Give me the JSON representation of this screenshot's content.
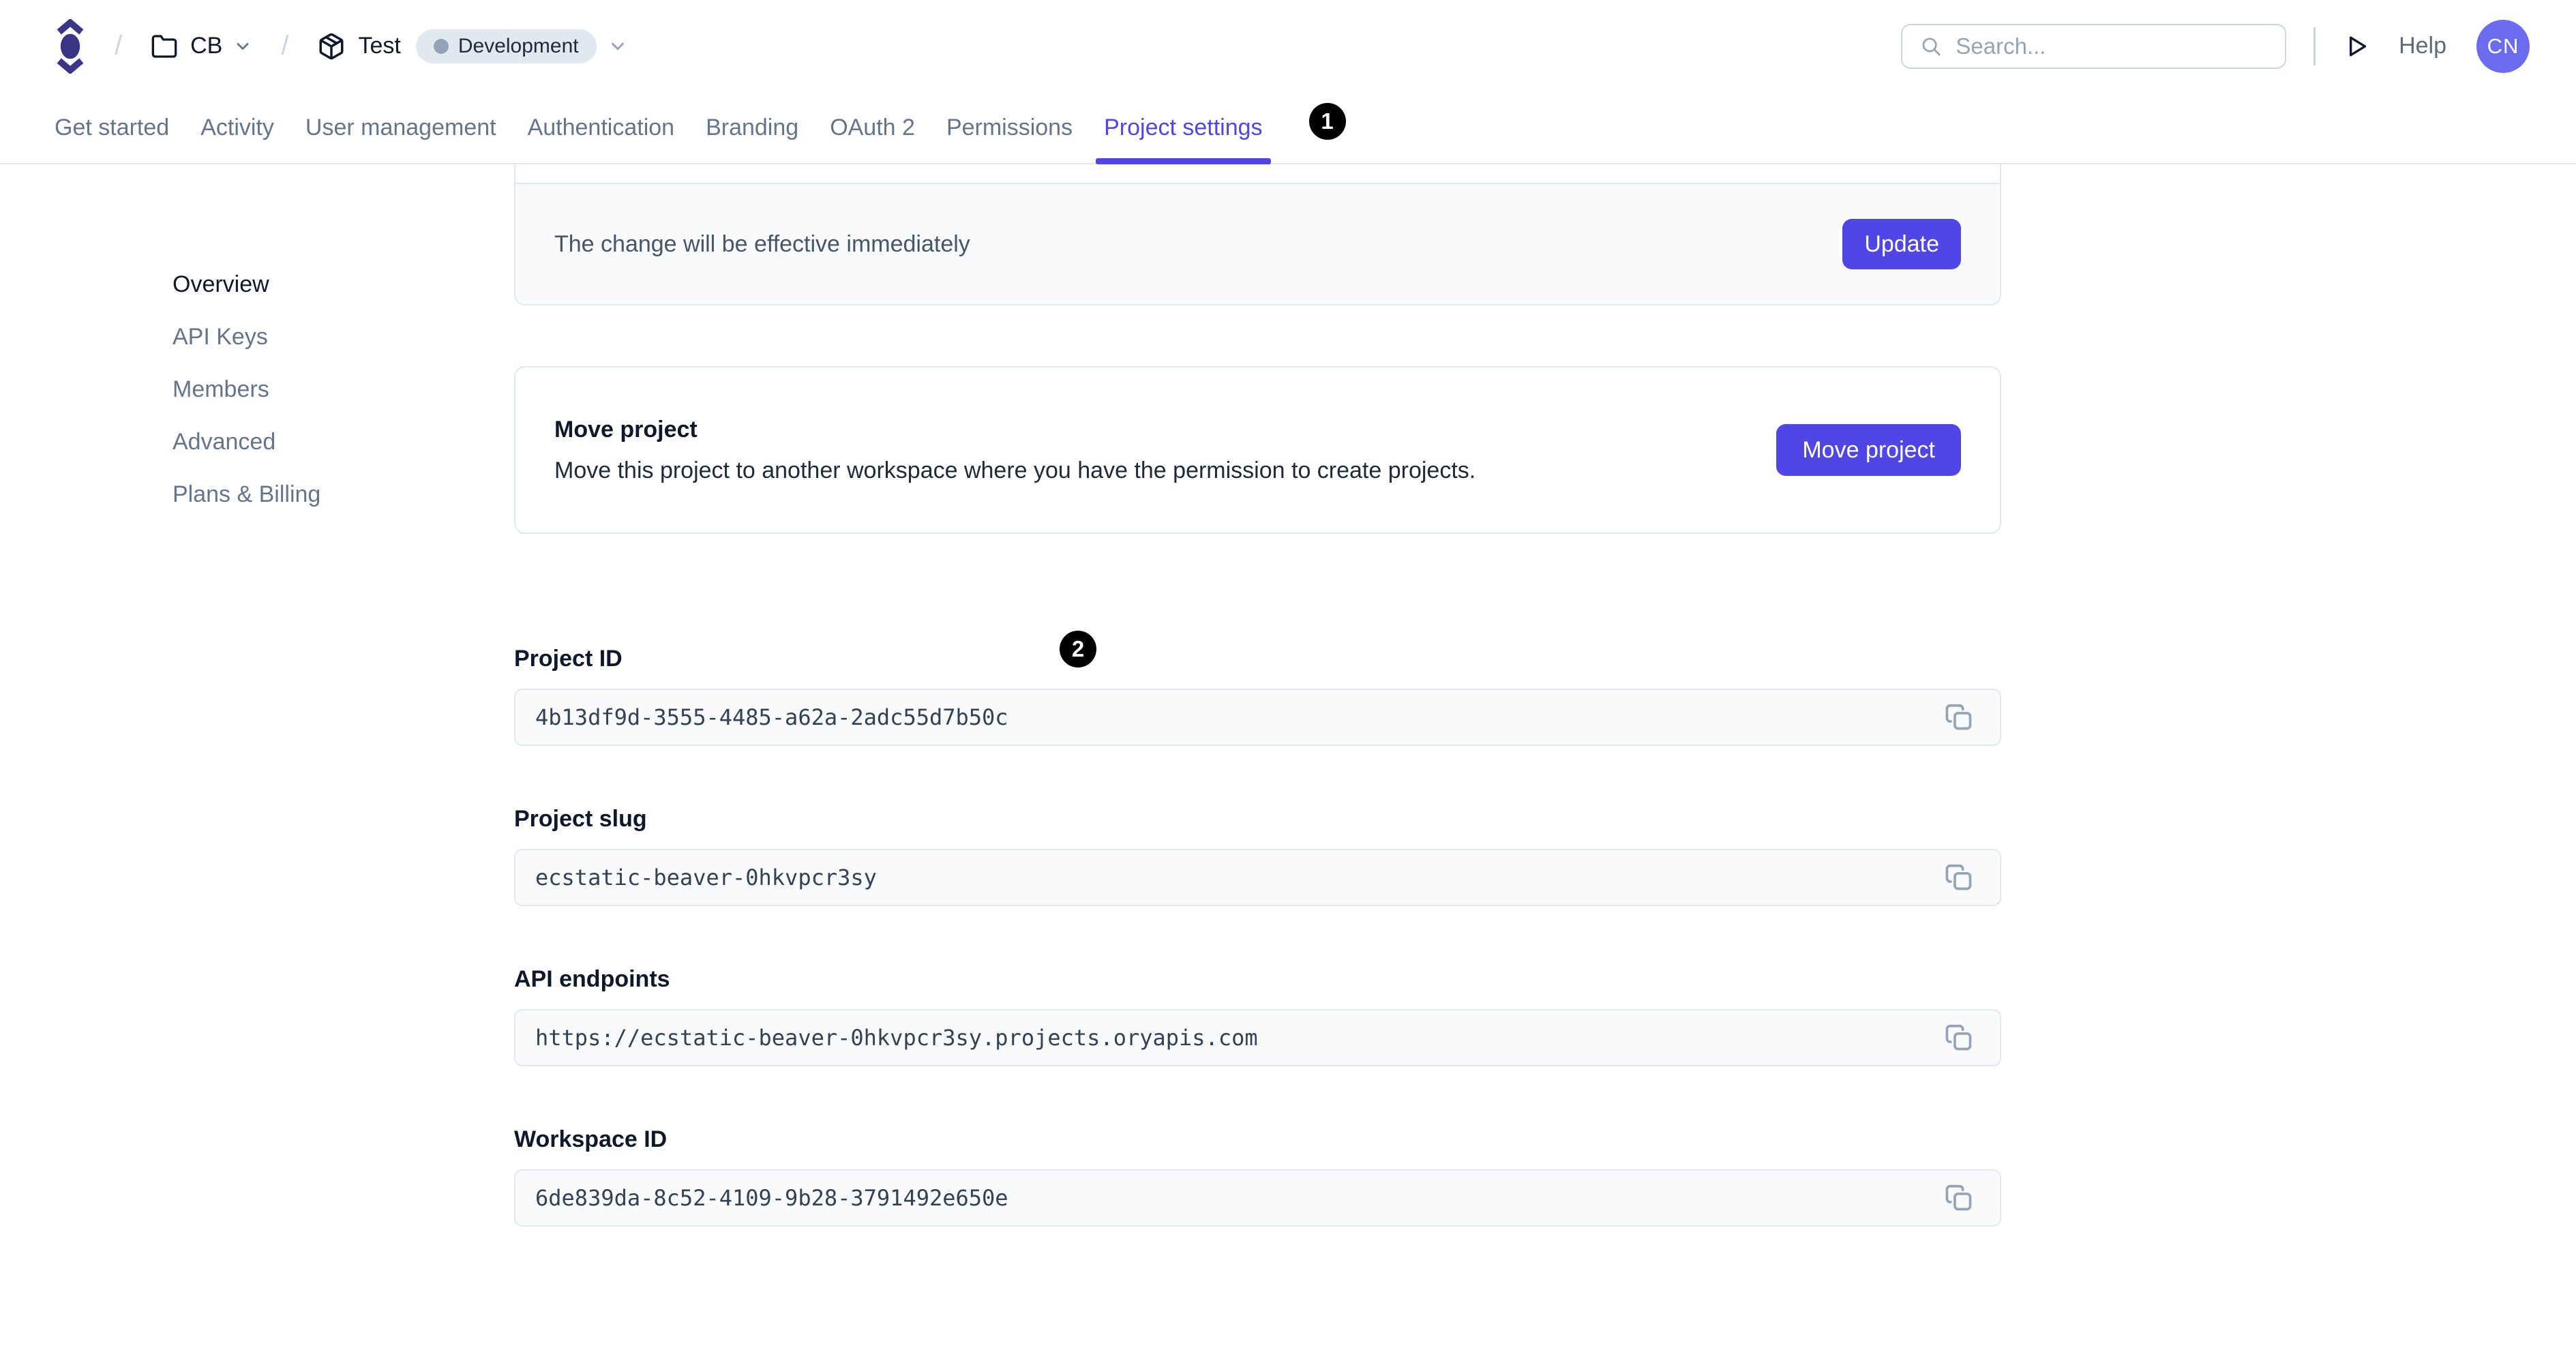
{
  "header": {
    "separator": "/",
    "workspace_label": "CB",
    "project_label": "Test",
    "environment_label": "Development",
    "search_placeholder": "Search...",
    "help_label": "Help",
    "avatar_initials": "CN"
  },
  "tabs": [
    {
      "label": "Get started"
    },
    {
      "label": "Activity"
    },
    {
      "label": "User management"
    },
    {
      "label": "Authentication"
    },
    {
      "label": "Branding"
    },
    {
      "label": "OAuth 2"
    },
    {
      "label": "Permissions"
    },
    {
      "label": "Project settings",
      "active": true
    }
  ],
  "annotations": {
    "tab_badge": "1",
    "content_badge": "2"
  },
  "sidebar": {
    "items": [
      {
        "label": "Overview",
        "active": true
      },
      {
        "label": "API Keys"
      },
      {
        "label": "Members"
      },
      {
        "label": "Advanced"
      },
      {
        "label": "Plans & Billing"
      }
    ]
  },
  "main": {
    "update_card": {
      "message": "The change will be effective immediately",
      "button_label": "Update"
    },
    "move_card": {
      "title": "Move project",
      "description": "Move this project to another workspace where you have the permission to create projects.",
      "button_label": "Move project"
    },
    "fields": [
      {
        "label": "Project ID",
        "value": "4b13df9d-3555-4485-a62a-2adc55d7b50c"
      },
      {
        "label": "Project slug",
        "value": "ecstatic-beaver-0hkvpcr3sy"
      },
      {
        "label": "API endpoints",
        "value": "https://ecstatic-beaver-0hkvpcr3sy.projects.oryapis.com"
      },
      {
        "label": "Workspace ID",
        "value": "6de839da-8c52-4109-9b28-3791492e650e"
      }
    ]
  },
  "colors": {
    "accent": "#4f46e5",
    "border": "#e2e8f0",
    "field_bg": "#f8fafc",
    "logo": "#3a3585",
    "avatar_bg": "#6b6cee",
    "annotation_badge_bg": "#000000"
  }
}
